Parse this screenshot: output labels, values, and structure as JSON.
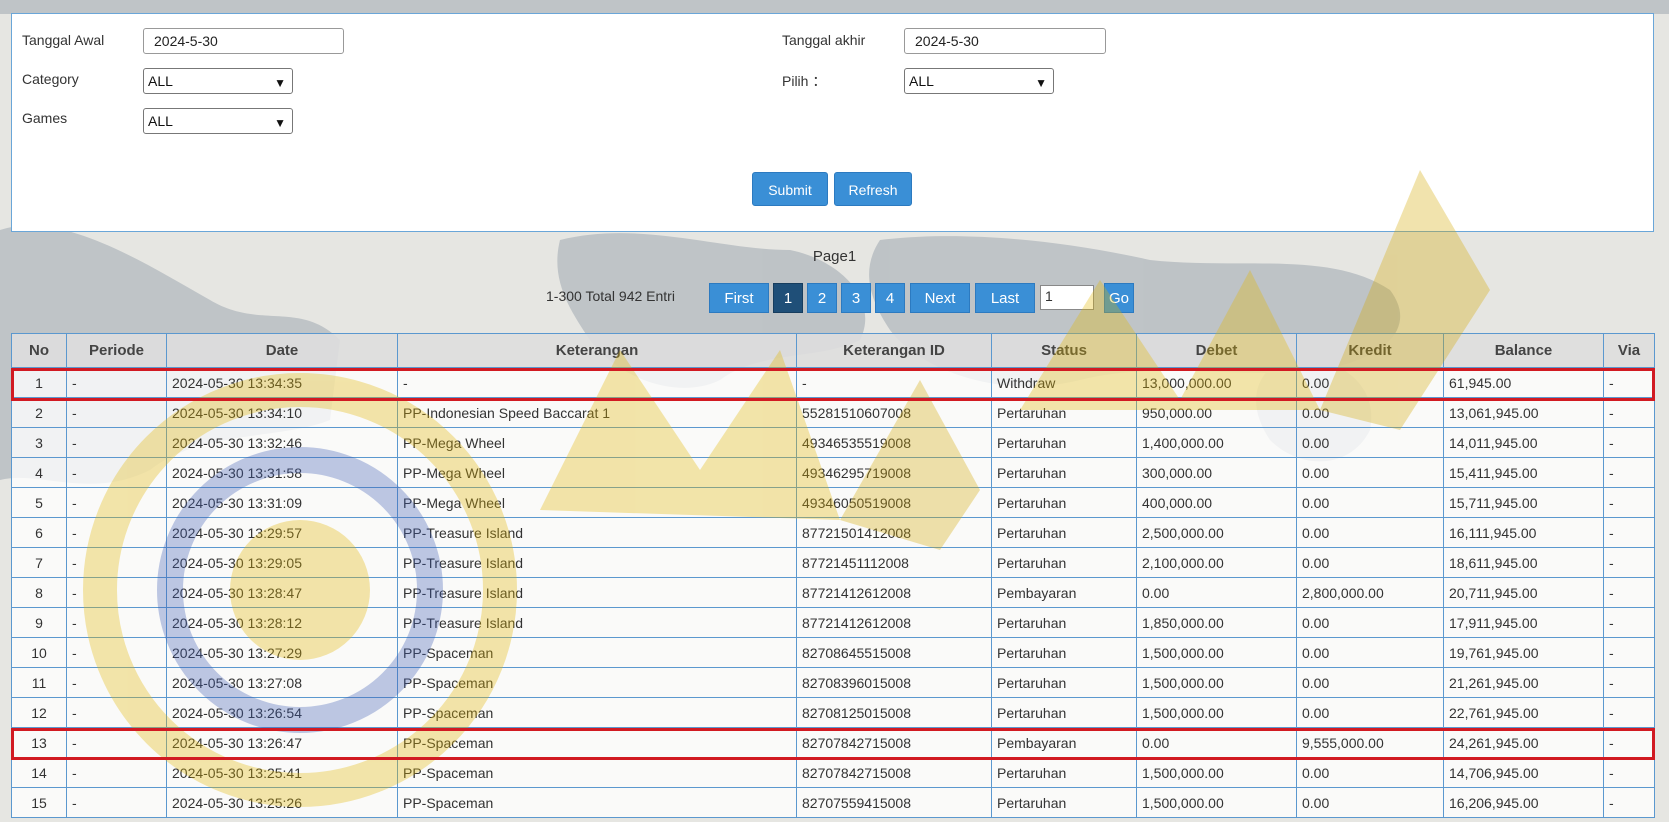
{
  "filters": {
    "tanggal_awal_label": "Tanggal Awal",
    "tanggal_awal_value": "2024-5-30",
    "tanggal_akhir_label": "Tanggal akhir",
    "tanggal_akhir_value": "2024-5-30",
    "category_label": "Category",
    "category_value": "ALL",
    "pilih_label": "Pilih ：",
    "pilih_value": "ALL",
    "games_label": "Games",
    "games_value": "ALL",
    "submit_label": "Submit",
    "refresh_label": "Refresh"
  },
  "pagination": {
    "title": "Page1",
    "total_text": "1-300 Total 942 Entri",
    "first_label": "First",
    "pages": [
      "1",
      "2",
      "3",
      "4"
    ],
    "current_page": "1",
    "next_label": "Next",
    "last_label": "Last",
    "goto_value": "1",
    "go_label": "Go"
  },
  "table": {
    "headers": [
      "No",
      "Periode",
      "Date",
      "Keterangan",
      "Keterangan ID",
      "Status",
      "Debet",
      "Kredit",
      "Balance",
      "Via"
    ],
    "rows": [
      [
        "1",
        "-",
        "2024-05-30 13:34:35",
        "-",
        "-",
        "Withdraw",
        "13,000,000.00",
        "0.00",
        "61,945.00",
        "-"
      ],
      [
        "2",
        "-",
        "2024-05-30 13:34:10",
        "PP-Indonesian Speed Baccarat 1",
        "55281510607008",
        "Pertaruhan",
        "950,000.00",
        "0.00",
        "13,061,945.00",
        "-"
      ],
      [
        "3",
        "-",
        "2024-05-30 13:32:46",
        "PP-Mega Wheel",
        "49346535519008",
        "Pertaruhan",
        "1,400,000.00",
        "0.00",
        "14,011,945.00",
        "-"
      ],
      [
        "4",
        "-",
        "2024-05-30 13:31:58",
        "PP-Mega Wheel",
        "49346295719008",
        "Pertaruhan",
        "300,000.00",
        "0.00",
        "15,411,945.00",
        "-"
      ],
      [
        "5",
        "-",
        "2024-05-30 13:31:09",
        "PP-Mega Wheel",
        "49346050519008",
        "Pertaruhan",
        "400,000.00",
        "0.00",
        "15,711,945.00",
        "-"
      ],
      [
        "6",
        "-",
        "2024-05-30 13:29:57",
        "PP-Treasure Island",
        "87721501412008",
        "Pertaruhan",
        "2,500,000.00",
        "0.00",
        "16,111,945.00",
        "-"
      ],
      [
        "7",
        "-",
        "2024-05-30 13:29:05",
        "PP-Treasure Island",
        "87721451112008",
        "Pertaruhan",
        "2,100,000.00",
        "0.00",
        "18,611,945.00",
        "-"
      ],
      [
        "8",
        "-",
        "2024-05-30 13:28:47",
        "PP-Treasure Island",
        "87721412612008",
        "Pembayaran",
        "0.00",
        "2,800,000.00",
        "20,711,945.00",
        "-"
      ],
      [
        "9",
        "-",
        "2024-05-30 13:28:12",
        "PP-Treasure Island",
        "87721412612008",
        "Pertaruhan",
        "1,850,000.00",
        "0.00",
        "17,911,945.00",
        "-"
      ],
      [
        "10",
        "-",
        "2024-05-30 13:27:29",
        "PP-Spaceman",
        "82708645515008",
        "Pertaruhan",
        "1,500,000.00",
        "0.00",
        "19,761,945.00",
        "-"
      ],
      [
        "11",
        "-",
        "2024-05-30 13:27:08",
        "PP-Spaceman",
        "82708396015008",
        "Pertaruhan",
        "1,500,000.00",
        "0.00",
        "21,261,945.00",
        "-"
      ],
      [
        "12",
        "-",
        "2024-05-30 13:26:54",
        "PP-Spaceman",
        "82708125015008",
        "Pertaruhan",
        "1,500,000.00",
        "0.00",
        "22,761,945.00",
        "-"
      ],
      [
        "13",
        "-",
        "2024-05-30 13:26:47",
        "PP-Spaceman",
        "82707842715008",
        "Pembayaran",
        "0.00",
        "9,555,000.00",
        "24,261,945.00",
        "-"
      ],
      [
        "14",
        "-",
        "2024-05-30 13:25:41",
        "PP-Spaceman",
        "82707842715008",
        "Pertaruhan",
        "1,500,000.00",
        "0.00",
        "14,706,945.00",
        "-"
      ],
      [
        "15",
        "-",
        "2024-05-30 13:25:26",
        "PP-Spaceman",
        "82707559415008",
        "Pertaruhan",
        "1,500,000.00",
        "0.00",
        "16,206,945.00",
        "-"
      ]
    ]
  },
  "colors": {
    "accent": "#3a8fd6",
    "active_page": "#1f4f78",
    "highlight": "#d11a22",
    "debit_red": "#c0262e"
  }
}
